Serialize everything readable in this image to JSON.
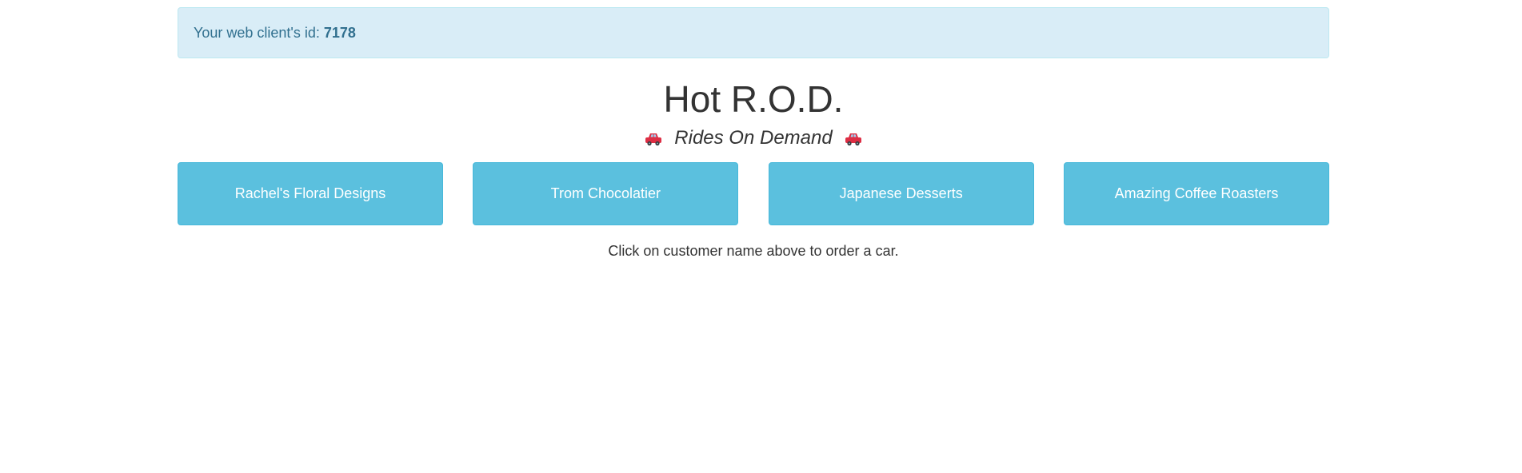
{
  "alert": {
    "prefix": "Your web client's id:",
    "client_id": "7178"
  },
  "header": {
    "title": "Hot R.O.D.",
    "subtitle": "Rides On Demand",
    "icon": "red-car-icon"
  },
  "customers": [
    {
      "label": "Rachel's Floral Designs"
    },
    {
      "label": "Trom Chocolatier"
    },
    {
      "label": "Japanese Desserts"
    },
    {
      "label": "Amazing Coffee Roasters"
    }
  ],
  "hint": "Click on customer name above to order a car.",
  "colors": {
    "alert_bg": "#d9edf7",
    "alert_text": "#31708f",
    "button_bg": "#5bc0de",
    "button_text": "#ffffff"
  }
}
